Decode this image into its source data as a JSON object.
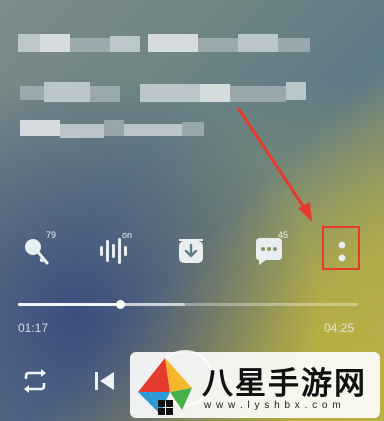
{
  "player": {
    "actions": [
      {
        "name": "sing-icon",
        "count": "79"
      },
      {
        "name": "sound-effect-icon",
        "count": "on"
      },
      {
        "name": "download-icon",
        "count": ""
      },
      {
        "name": "comment-icon",
        "count": "45"
      },
      {
        "name": "more-icon",
        "count": ""
      }
    ],
    "progress": {
      "elapsed": "01:17",
      "total": "04:25",
      "fraction": 0.3,
      "buffered_fraction": 0.49
    }
  },
  "watermark": {
    "title": "八星手游网",
    "url": "w w w . l y s h b x . c o m"
  },
  "colors": {
    "highlight": "#e53b2e",
    "icon": "#e9eef0"
  }
}
